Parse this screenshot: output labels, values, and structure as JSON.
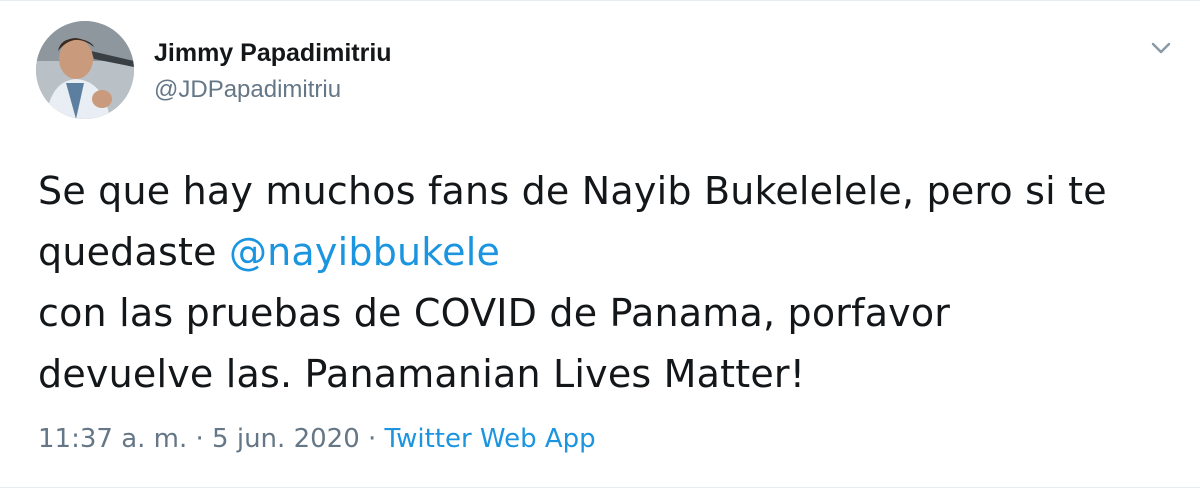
{
  "user": {
    "display_name": "Jimmy Papadimitriu",
    "handle": "@JDPapadimitriu"
  },
  "tweet": {
    "line1": "Se que hay muchos fans de Nayib Bukelelele, pero si te",
    "line2_prefix": "quedaste ",
    "mention": "@nayibbukele",
    "line3": "con las pruebas de COVID de Panama, porfavor",
    "line4": "devuelve las. Panamanian Lives Matter!"
  },
  "meta": {
    "time": "11:37 a. m.",
    "sep1": " · ",
    "date": "5 jun. 2020",
    "sep2": " · ",
    "source": "Twitter Web App"
  },
  "icons": {
    "avatar": "profile-photo",
    "caret": "chevron-down-icon"
  },
  "colors": {
    "link": "#1b95e0",
    "secondary_text": "#657786",
    "primary_text": "#14171a"
  }
}
